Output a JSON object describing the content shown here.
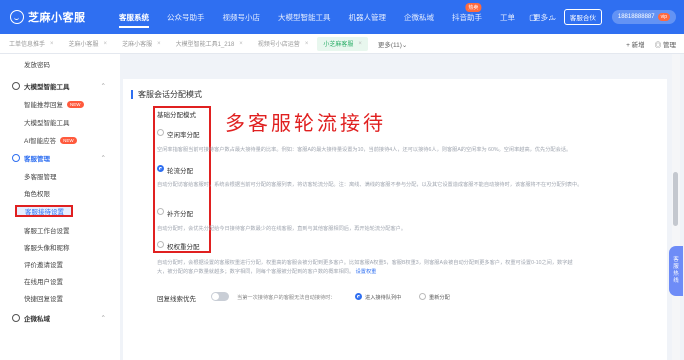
{
  "app": {
    "logo_text": "芝麻小客服"
  },
  "nav": {
    "items": [
      "客服系统",
      "公众号助手",
      "视频号小店",
      "大模型智能工具",
      "机器人管理",
      "企微私域",
      "抖音助手",
      "工单",
      "更多"
    ],
    "active_index": 0,
    "badge_label": "热卖",
    "badge_index": 6,
    "more_caret": "⌄"
  },
  "topright": {
    "button_label": "客服合伙",
    "user_text": "18818888887",
    "pill": "vip"
  },
  "tabs": {
    "items": [
      "工单信息推手",
      "芝麻小客服",
      "芝麻小客服",
      "大模型智能工具1_218",
      "视频号小店运营",
      "小芝麻客服"
    ],
    "active_index": 5,
    "more_label": "更多(11)⌄",
    "new_label": "+ 新增",
    "manage_label": "◎ 管理"
  },
  "sidebar": {
    "top_partial": "发放密码",
    "group1": "大模型智能工具",
    "group1_items": [
      "智能推荐回复",
      "大模型智能工具",
      "AI智能应答"
    ],
    "new_badge": "NEW",
    "group2": "客服管理",
    "group2_items": [
      "多客服管理",
      "角色权限",
      "客服接待设置",
      "客服工作台设置",
      "客服头像和昵称",
      "评价邀请设置",
      "在线用户设置",
      "快捷回复设置"
    ],
    "group3": "企微私域",
    "caret": "⌃"
  },
  "content": {
    "section_title": "客服会话分配模式",
    "basic_label": "基础分配模式",
    "annotation": "多客服轮流接待",
    "option1_label": "空闲率分配",
    "option1_desc": "空闲率指客服当前可接待客户数占最大接待量的比率。例如：客服A的最大接待量设置为10，当前接待4人，还可以接待6人，则客服A的空闲率为 60%。空闲率越高，优先分配会话。",
    "option2_label": "轮流分配",
    "option2_desc": "自动分配访客给客服时，系统会根据当前可分配的客服列表，将访客轮流分配。注：离线、满线的客服不参与分配，以及其它设置造成客服不能自动接待时，该客服将不在可分配列表中。",
    "option3_label": "补齐分配",
    "option3_desc": "自动分配时，会优先分配给今日接待客户数最少的在线客服，直到与其他客服相同后，再开始轮流分配客户。",
    "option4_label": "权权重分配",
    "weight_desc1": "自动分配时，会根据设置的客服权重进行分配，权重高的客服会被分配到更多客户。比如客服A权重5，客服B权重3，则客服A会被自动分配到更多客户，权重可设置0-10之间，数字越",
    "weight_desc2": "大，被分配的客户数量就越多；数字相同，则每个客服被分配到的客户数的概率相同。",
    "weight_link": "设置权重",
    "toggle_label": "回复线索优先",
    "toggle_desc": "当第一次接待客户的客服无法自动接待时：",
    "radio_a": "进入接待队列中",
    "radio_b": "重新分配"
  },
  "float": {
    "line1": "客",
    "line2": "服",
    "line3": "热",
    "line4": "线"
  },
  "colors": {
    "primary": "#2f6ff1",
    "annotation_red": "#e02020"
  }
}
